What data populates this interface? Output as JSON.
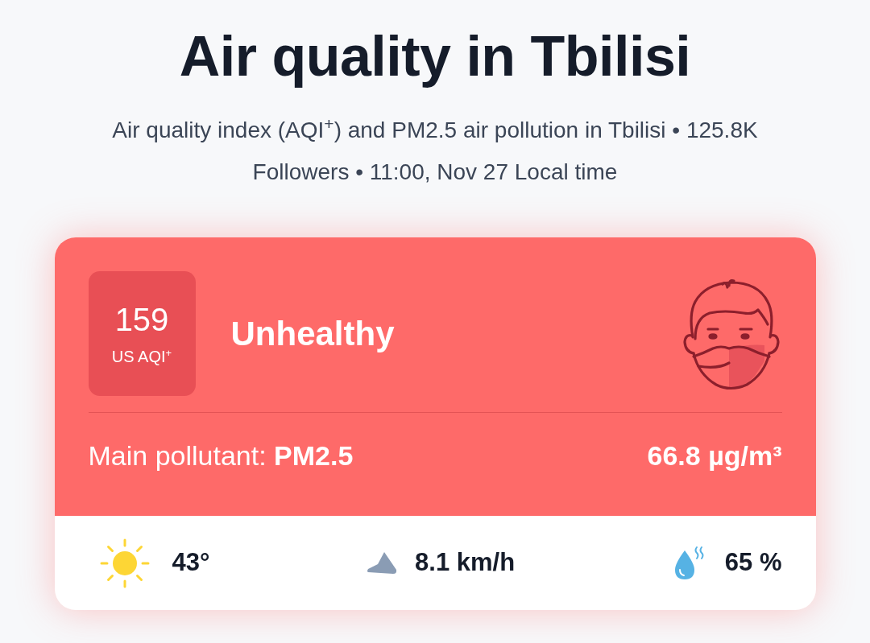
{
  "title": "Air quality in Tbilisi",
  "subtitle": "Air quality index (AQI$^{+}$) and PM2.5 air pollution in Tbilisi • 125.8K Followers • 11:00, Nov 27 Local time",
  "aqi_card": {
    "aqi_value": "159",
    "aqi_unit": "US AQI$^{+}$",
    "status": "Unhealthy",
    "main_pollutant": "Main pollutant: **PM2.5**",
    "concentration": "66.8 µg/m³"
  },
  "weather": [
    {
      "kind": "temperature",
      "value": "43°"
    },
    {
      "kind": "wind",
      "value": "8.1 km/h"
    },
    {
      "kind": "humidity",
      "value": "65 %"
    }
  ]
}
